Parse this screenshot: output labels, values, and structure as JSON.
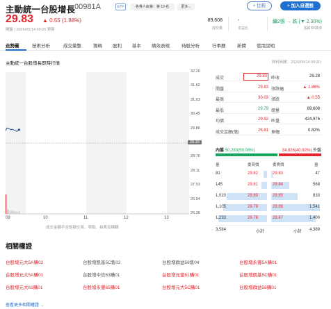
{
  "header": {
    "name": "主動統一台股增長",
    "code": "00981A",
    "tags": [
      "ETF",
      "各券人氣第：第 13 名",
      "更多..."
    ],
    "compare_label": "比較",
    "watch_label": "加入自選股"
  },
  "quote": {
    "price": "29.83",
    "change": "▲ 0.55 (1.88%)",
    "timestamp": "開盤 | 2026/05/14 09:20 更新",
    "volume_value": "89,608",
    "volume_label": "成交量",
    "dash_value": "-",
    "dash_label": "本益比",
    "rank_value": "續2張 → 跌 (▼ 2.30%)",
    "rank_label": "漲跌停/跌停"
  },
  "tabs": [
    "走勢圖",
    "技術分析",
    "成交彙整",
    "籌碼",
    "股利",
    "基本",
    "績效表現",
    "持股分析",
    "行事曆",
    "新聞",
    "使用說明"
  ],
  "chart_section": {
    "title": "主動統一台股增長即時行情",
    "data_time": "資料時間：2026/05/14 09:20",
    "note": "成交金額不含鉅額交易、零股、拍賣及標購"
  },
  "chart_data": {
    "type": "line",
    "title": "",
    "ylim": [
      26.36,
      32.2
    ],
    "yticks": [
      "32.20",
      "31.62",
      "31.03",
      "30.45",
      "29.86",
      "29.28",
      "28.70",
      "28.11",
      "27.53",
      "26.94",
      "26.36"
    ],
    "ref_price": "29.28",
    "xticks": [
      "09",
      "10",
      "11",
      "12",
      "13"
    ],
    "series": [
      {
        "x": [
          "09:00",
          "09:02",
          "09:04",
          "09:06",
          "09:08",
          "09:10",
          "09:12",
          "09:14",
          "09:16",
          "09:18",
          "09:20"
        ],
        "values": [
          29.78,
          29.9,
          29.88,
          29.86,
          29.83,
          29.85,
          29.82,
          29.8,
          29.76,
          29.78,
          29.83
        ]
      }
    ],
    "volume": [
      8200,
      2100,
      1600,
      1400,
      1200,
      1500,
      1100,
      900,
      1000,
      800,
      1200
    ]
  },
  "stats": [
    {
      "l": "成交",
      "v1": "29.83",
      "r": "昨收",
      "v2": "29.28"
    },
    {
      "l": "開盤",
      "v1": "29.83",
      "r": "漲跌幅",
      "v2": "▲ 1.88%"
    },
    {
      "l": "最高",
      "v1": "30.03",
      "r": "漲跌",
      "v2": "▲ 0.55"
    },
    {
      "l": "最低",
      "v1": "29.79",
      "r": "總量",
      "v2": "89,608"
    },
    {
      "l": "均價",
      "v1": "29.92",
      "r": "昨量",
      "v2": "424,976"
    },
    {
      "l": "成交金額(億)",
      "v1": "26.81",
      "r": "振幅",
      "v2": "0.82%"
    }
  ],
  "in_out": {
    "in_label": "內盤",
    "in_value": "50,283(59.08%)",
    "out_value": "34,826(40.92%)",
    "out_label": "外盤",
    "in_ratio": 0.5908
  },
  "orderbook": {
    "headers": [
      "量",
      "委買價",
      "委賣價",
      "量"
    ],
    "rows": [
      {
        "bv": "81",
        "bp": "29.82",
        "ap": "29.83",
        "av": "47"
      },
      {
        "bv": "145",
        "bp": "29.81",
        "ap": "29.84",
        "av": "568"
      },
      {
        "bv": "1,020",
        "bp": "29.80",
        "ap": "29.85",
        "av": "833"
      },
      {
        "bv": "1,105",
        "bp": "29.79",
        "ap": "29.86",
        "av": "1,541"
      },
      {
        "bv": "1,233",
        "bp": "29.78",
        "ap": "29.87",
        "av": "1,400"
      }
    ],
    "bid_ratios": [
      0.07,
      0.12,
      0.83,
      0.9,
      1.0
    ],
    "ask_ratios": [
      0.03,
      0.37,
      0.54,
      1.0,
      0.91
    ],
    "bid_total": "3,584",
    "bid_total_label": "小計",
    "ask_total_label": "小計",
    "ask_total": "4,389"
  },
  "related": {
    "title": "相關權證",
    "items": [
      {
        "label": "台股增元大5A購02",
        "color": "#e3262e"
      },
      {
        "label": "台股增凱基5C售02",
        "color": "#555555"
      },
      {
        "label": "台股增群益58售04",
        "color": "#555555"
      },
      {
        "label": "台股增永豐5A購01",
        "color": "#e3262e"
      },
      {
        "label": "台股增元大5A購01",
        "color": "#e3262e"
      },
      {
        "label": "台股增中信63購01",
        "color": "#555555"
      },
      {
        "label": "台股增元富61購01",
        "color": "#e3262e"
      },
      {
        "label": "台股增凱基5C購01",
        "color": "#e3262e"
      },
      {
        "label": "台股增元大61購01",
        "color": "#e3262e"
      },
      {
        "label": "台股增永豐65購01",
        "color": "#e3262e"
      },
      {
        "label": "台股增元大5C購01",
        "color": "#e3262e"
      },
      {
        "label": "台股增群益58購01",
        "color": "#e3262e"
      }
    ],
    "more_label": "查看更多相關權證 →"
  },
  "colors": {
    "up": "#e3262e",
    "down": "#1aa260",
    "accent": "#1f6fd1",
    "line": "#2a4d8f"
  }
}
